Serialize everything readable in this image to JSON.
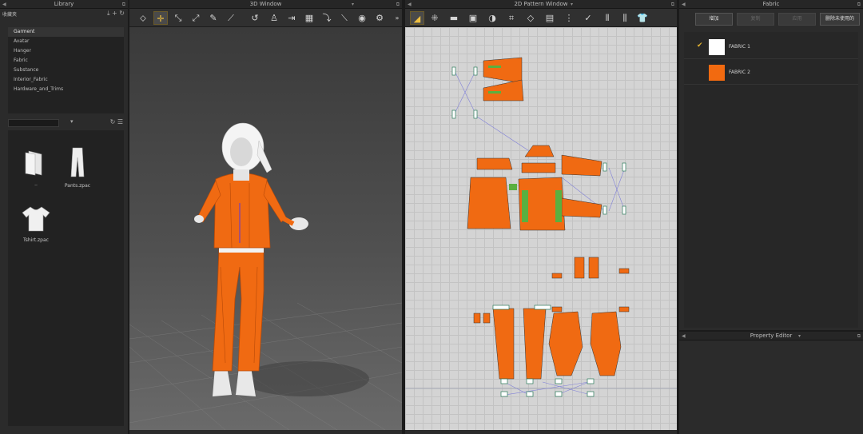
{
  "library": {
    "title": "Library",
    "header": "收藏夹",
    "tree": [
      "Garment",
      "Avatar",
      "Hanger",
      "Fabric",
      "Substance",
      "Interior_Fabric",
      "Hardware_and_Trims"
    ],
    "files": [
      {
        "name": "..",
        "icon": "folder-icon"
      },
      {
        "name": "Pants.zpac",
        "icon": "pants-icon"
      },
      {
        "name": "Tshirt.zpac",
        "icon": "tshirt-icon"
      }
    ]
  },
  "window3d": {
    "title": "3D Window"
  },
  "window2d": {
    "title": "2D Pattern Window"
  },
  "fabric": {
    "title": "Fabric",
    "buttons": [
      "增加",
      "复制",
      "应用",
      "删除未使用的"
    ],
    "items": [
      {
        "name": "FABRIC 1",
        "color": "#ffffff",
        "selected": true
      },
      {
        "name": "FABRIC 2",
        "color": "#f26a10",
        "selected": false
      }
    ]
  },
  "property": {
    "title": "Property Editor"
  },
  "colors": {
    "accent": "#f0b030",
    "garment": "#f26a10"
  }
}
